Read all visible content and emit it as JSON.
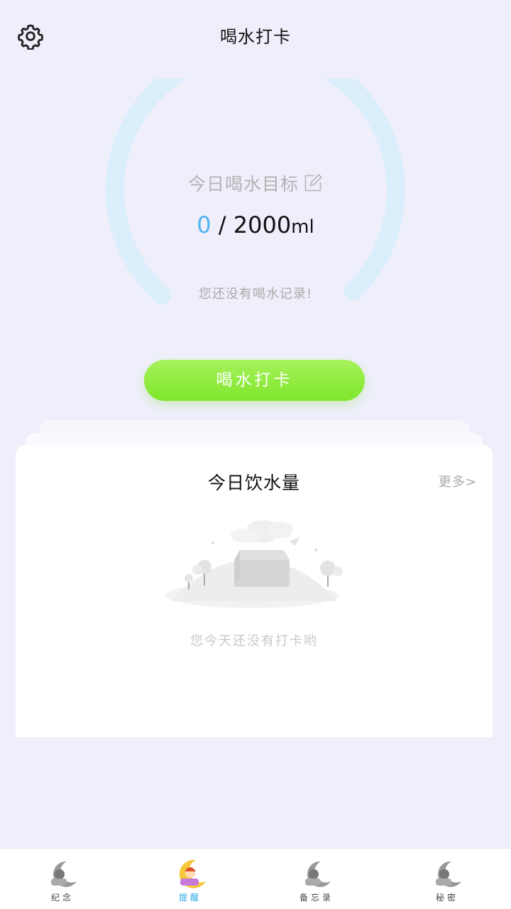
{
  "header": {
    "title": "喝水打卡",
    "settings_icon": "gear-icon"
  },
  "goal": {
    "label": "今日喝水目标",
    "edit_icon": "edit-icon",
    "current": "0",
    "separator": " / ",
    "target": "2000",
    "unit": "ml",
    "progress_fraction": 0,
    "empty_message": "您还没有喝水记录!"
  },
  "checkin_button": {
    "label": "喝水打卡"
  },
  "today_card": {
    "title": "今日饮水量",
    "more_label": "更多>",
    "empty_illustration": "empty-box-illustration",
    "empty_text": "您今天还没有打卡哟"
  },
  "tabbar": {
    "items": [
      {
        "label": "纪念",
        "icon": "moon-girl-icon",
        "active": false
      },
      {
        "label": "提醒",
        "icon": "moon-girl-icon",
        "active": true
      },
      {
        "label": "备忘录",
        "icon": "moon-girl-icon",
        "active": false
      },
      {
        "label": "秘密",
        "icon": "moon-girl-icon",
        "active": false
      }
    ]
  },
  "colors": {
    "background": "#efeffb",
    "ring": "#dbeefb",
    "current_value": "#4fb3f0",
    "button_green": "#8ceb3c",
    "active_tab": "#28a8e8"
  }
}
